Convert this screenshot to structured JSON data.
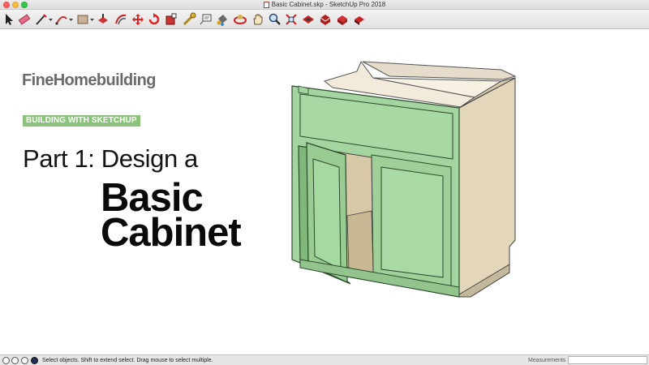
{
  "window": {
    "title": "Basic Cabinet.skp - SketchUp Pro 2018"
  },
  "toolbar": {
    "tools": [
      {
        "name": "select-tool",
        "icon": "cursor-arrow-icon"
      },
      {
        "name": "eraser-tool",
        "icon": "eraser-icon"
      },
      {
        "name": "line-tool",
        "icon": "pencil-line-icon"
      },
      {
        "name": "arc-tool",
        "icon": "arc-icon"
      },
      {
        "name": "rectangle-tool",
        "icon": "rectangle-icon"
      },
      {
        "name": "push-pull-tool",
        "icon": "push-pull-icon"
      },
      {
        "name": "offset-tool",
        "icon": "offset-icon"
      },
      {
        "name": "move-tool",
        "icon": "move-arrows-icon"
      },
      {
        "name": "rotate-tool",
        "icon": "rotate-icon"
      },
      {
        "name": "scale-tool",
        "icon": "scale-icon"
      },
      {
        "name": "tape-measure-tool",
        "icon": "tape-measure-icon"
      },
      {
        "name": "text-tool",
        "icon": "text-label-icon"
      },
      {
        "name": "paint-bucket-tool",
        "icon": "paint-bucket-icon"
      },
      {
        "name": "orbit-tool",
        "icon": "orbit-icon"
      },
      {
        "name": "pan-tool",
        "icon": "hand-pan-icon"
      },
      {
        "name": "zoom-tool",
        "icon": "magnifier-icon"
      },
      {
        "name": "zoom-extents-tool",
        "icon": "zoom-extents-icon"
      },
      {
        "name": "warehouse-tool",
        "icon": "3d-warehouse-icon"
      },
      {
        "name": "share-model-tool",
        "icon": "share-model-icon"
      },
      {
        "name": "extension-warehouse-tool",
        "icon": "extension-warehouse-icon"
      },
      {
        "name": "layout-tool",
        "icon": "send-to-layout-icon"
      }
    ]
  },
  "viewport": {
    "brand": "FineHomebuilding",
    "badge": "BUILDING WITH SKETCHUP",
    "part_line": "Part 1: Design a",
    "big_line_1": "Basic",
    "big_line_2": "Cabinet",
    "colors": {
      "cabinet_green": "#a4d4a0",
      "cabinet_side": "#e3d6ba",
      "badge_green": "#8cc37c",
      "brand_gray": "#6b6b6b"
    }
  },
  "status": {
    "message": "Select objects. Shift to extend select. Drag mouse to select multiple.",
    "measurements_label": "Measurements",
    "measurements_value": ""
  }
}
